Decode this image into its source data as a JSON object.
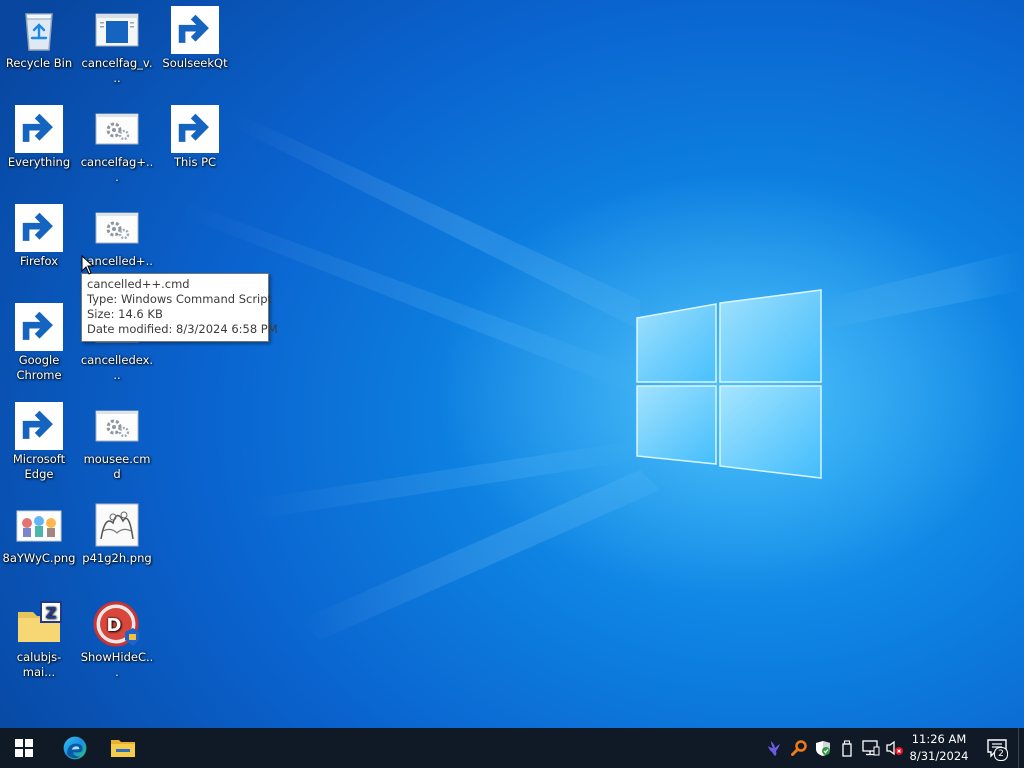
{
  "desktop": {
    "icons": [
      {
        "label": "Recycle Bin",
        "icon": "recycle-bin-icon"
      },
      {
        "label": "cancelfag_v...",
        "icon": "document-window-icon"
      },
      {
        "label": "SoulseekQt",
        "icon": "soulseek-bird-icon"
      },
      {
        "label": "Everything",
        "icon": "everything-magnifier-icon"
      },
      {
        "label": "cancelfag+...",
        "icon": "cmd-script-gear-icon"
      },
      {
        "label": "This PC",
        "icon": "this-pc-monitor-icon"
      },
      {
        "label": "Firefox",
        "icon": "firefox-icon"
      },
      {
        "label": "cancelled+...",
        "icon": "cmd-script-gear-icon"
      },
      {
        "label": "Google Chrome",
        "icon": "chrome-icon"
      },
      {
        "label": "cancelledex...",
        "icon": "cmd-script-gear-icon"
      },
      {
        "label": "Microsoft Edge",
        "icon": "edge-icon"
      },
      {
        "label": "mousee.cmd",
        "icon": "cmd-script-gear-icon"
      },
      {
        "label": "8aYWyC.png",
        "icon": "png-image-icon"
      },
      {
        "label": "p41g2h.png",
        "icon": "png-image-icon"
      },
      {
        "label": "calubjs-mai...",
        "icon": "zip-folder-icon"
      },
      {
        "label": "ShowHideC...",
        "icon": "showhide-app-icon"
      }
    ]
  },
  "tooltip": {
    "name": "cancelled++.cmd",
    "type": "Type: Windows Command Script",
    "size": "Size: 14.6 KB",
    "modified": "Date modified: 8/3/2024 6:58 PM"
  },
  "taskbar": {
    "pinned": [
      "start-windows-icon",
      "edge-icon",
      "file-explorer-icon"
    ],
    "tray": [
      "soulseek-tray-icon",
      "everything-tray-icon",
      "defender-shield-icon",
      "usb-device-icon",
      "network-icon",
      "volume-muted-icon"
    ],
    "time": "11:26 AM",
    "date": "8/31/2024",
    "notification_count": "2"
  },
  "colors": {
    "taskbar": "#101a26",
    "desktop_blue": "#0d7fe0",
    "accent": "#6fb6f2"
  }
}
